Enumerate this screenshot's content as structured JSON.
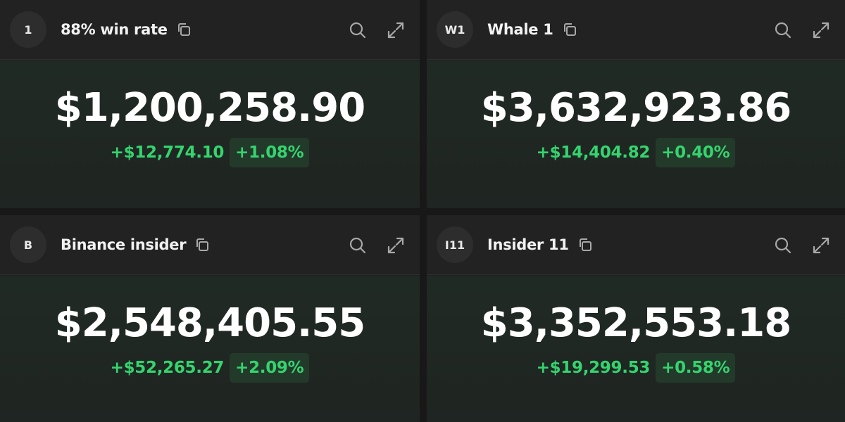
{
  "colors": {
    "background": "#181818",
    "panel_header": "#222222",
    "panel_body": "#202a24",
    "positive_text": "#35d46e",
    "positive_badge_bg": "#233a2b",
    "icon": "#a8a8a8"
  },
  "wallets": [
    {
      "avatar": "1",
      "name": "88% win rate",
      "total": "$1,200,258.90",
      "change_abs": "+$12,774.10",
      "change_pct": "+1.08%",
      "icons": [
        "copy-icon",
        "search-icon",
        "expand-icon"
      ]
    },
    {
      "avatar": "W1",
      "name": "Whale 1",
      "total": "$3,632,923.86",
      "change_abs": "+$14,404.82",
      "change_pct": "+0.40%",
      "icons": [
        "copy-icon",
        "search-icon",
        "expand-icon"
      ]
    },
    {
      "avatar": "B",
      "name": "Binance insider",
      "total": "$2,548,405.55",
      "change_abs": "+$52,265.27",
      "change_pct": "+2.09%",
      "icons": [
        "copy-icon",
        "search-icon",
        "expand-icon"
      ]
    },
    {
      "avatar": "I11",
      "name": "Insider 11",
      "total": "$3,352,553.18",
      "change_abs": "+$19,299.53",
      "change_pct": "+0.58%",
      "icons": [
        "copy-icon",
        "search-icon",
        "expand-icon"
      ]
    }
  ]
}
